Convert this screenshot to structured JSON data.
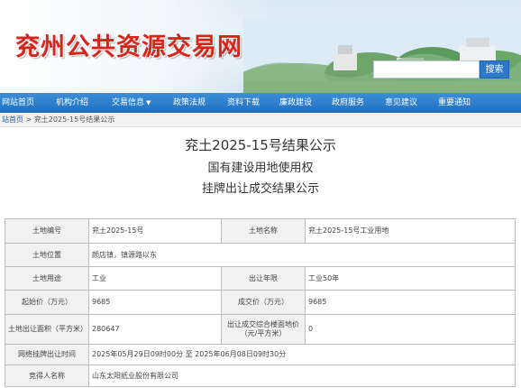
{
  "header": {
    "site_title": "兖州公共资源交易网",
    "search_button": "搜索",
    "search_value": ""
  },
  "nav": {
    "items": [
      {
        "label": "网站首页"
      },
      {
        "label": "机构介绍"
      },
      {
        "label": "交易信息",
        "has_dropdown": true
      },
      {
        "label": "政策法规"
      },
      {
        "label": "资料下载"
      },
      {
        "label": "廉政建设"
      },
      {
        "label": "政府服务"
      },
      {
        "label": "意见建议"
      },
      {
        "label": "重要通知"
      }
    ]
  },
  "breadcrumb": {
    "home": "站首页",
    "separator": ">",
    "current": "兖土2025-15号结果公示"
  },
  "article": {
    "title": "兖土2025-15号结果公示",
    "subtitle1": "国有建设用地使用权",
    "subtitle2": "挂牌出让成交结果公示"
  },
  "table": {
    "rows": [
      {
        "l1": "土地编号",
        "v1": "兖土2025-15号",
        "l2": "土地名称",
        "v2": "兖土2025-15号工业用地"
      },
      {
        "l1": "土地位置",
        "v1": "颜店镇，镇源路以东"
      },
      {
        "l1": "土地用途",
        "v1": "工业",
        "l2": "出让年限",
        "v2": "工业50年"
      },
      {
        "l1": "起始价（万元）",
        "v1": "9685",
        "l2": "成交价（万元）",
        "v2": "9685"
      },
      {
        "l1": "土地出让面积（平方米）",
        "v1": "280647",
        "l2": "出让成交综合楼面地价（元/平方米）",
        "v2": "0"
      },
      {
        "l1": "网络挂牌出让时间",
        "v1": "2025年05月29日09时00分 至 2025年06月08日09时30分"
      },
      {
        "l1": "竞得人名称",
        "v1": "山东太阳纸业股份有限公司"
      }
    ]
  },
  "colors": {
    "title_red": "#d6261c",
    "nav_blue": "#1f6fbf",
    "search_blue": "#2d78c8"
  }
}
